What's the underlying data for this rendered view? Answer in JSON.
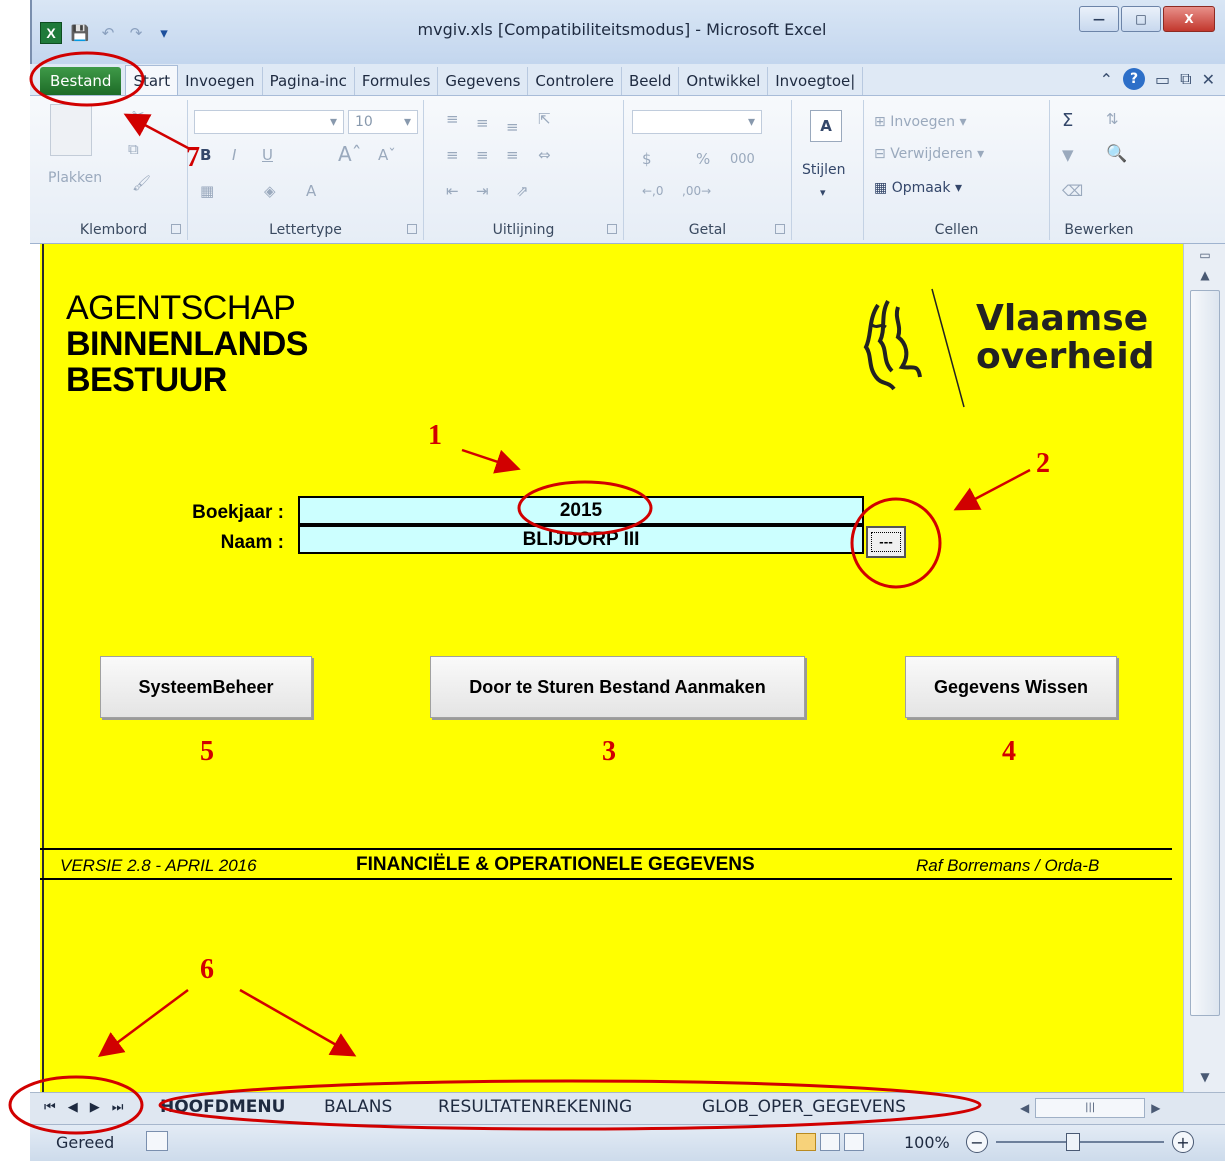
{
  "window": {
    "title": "mvgiv.xls  [Compatibiliteitsmodus]  -  Microsoft Excel"
  },
  "ribbon_tabs": [
    "Bestand",
    "Start",
    "Invoegen",
    "Pagina-inc",
    "Formules",
    "Gegevens",
    "Controlere",
    "Beeld",
    "Ontwikkel",
    "Invoegtoe|"
  ],
  "ribbon": {
    "klembord": {
      "paste_label": "Plakken",
      "group_label": "Klembord"
    },
    "lettertype": {
      "font_size": "10",
      "bold": "B",
      "italic": "I",
      "underline": "U",
      "group_label": "Lettertype"
    },
    "uitlijning": {
      "group_label": "Uitlijning"
    },
    "getal": {
      "currency": "$",
      "percent": "%",
      "thousands": "000",
      "group_label": "Getal"
    },
    "stijlen": {
      "label": "Stijlen"
    },
    "cellen": {
      "insert": "Invoegen",
      "delete": "Verwijderen",
      "format": "Opmaak",
      "group_label": "Cellen"
    },
    "bewerken": {
      "group_label": "Bewerken"
    }
  },
  "sheet": {
    "agency": [
      "AGENTSCHAP",
      "BINNENLANDS",
      "BESTUUR"
    ],
    "logo_text": [
      "Vlaamse",
      "overheid"
    ],
    "form": {
      "year_label": "Boekjaar :",
      "year_value": "2015",
      "name_label": "Naam :",
      "name_value": "BLIJDORP III",
      "ellipsis": "---"
    },
    "buttons": {
      "system": "SysteemBeheer",
      "create_file": "Door te Sturen Bestand Aanmaken",
      "clear_data": "Gegevens Wissen"
    },
    "footer": {
      "version": "VERSIE 2.8  - APRIL 2016",
      "title": "FINANCIËLE & OPERATIONELE GEGEVENS",
      "author": "Raf Borremans / Orda-B"
    }
  },
  "annotations": [
    "1",
    "2",
    "3",
    "4",
    "5",
    "6",
    "7"
  ],
  "sheet_tabs": [
    "HOOFDMENU",
    "BALANS",
    "RESULTATENREKENING",
    "GLOB_OPER_GEGEVENS"
  ],
  "status": {
    "ready": "Gereed",
    "zoom": "100%"
  },
  "colors": {
    "sheet_bg": "#ffff00",
    "input_bg": "#ccffff",
    "annotation": "#d10000",
    "file_tab": "#2a7f34"
  }
}
